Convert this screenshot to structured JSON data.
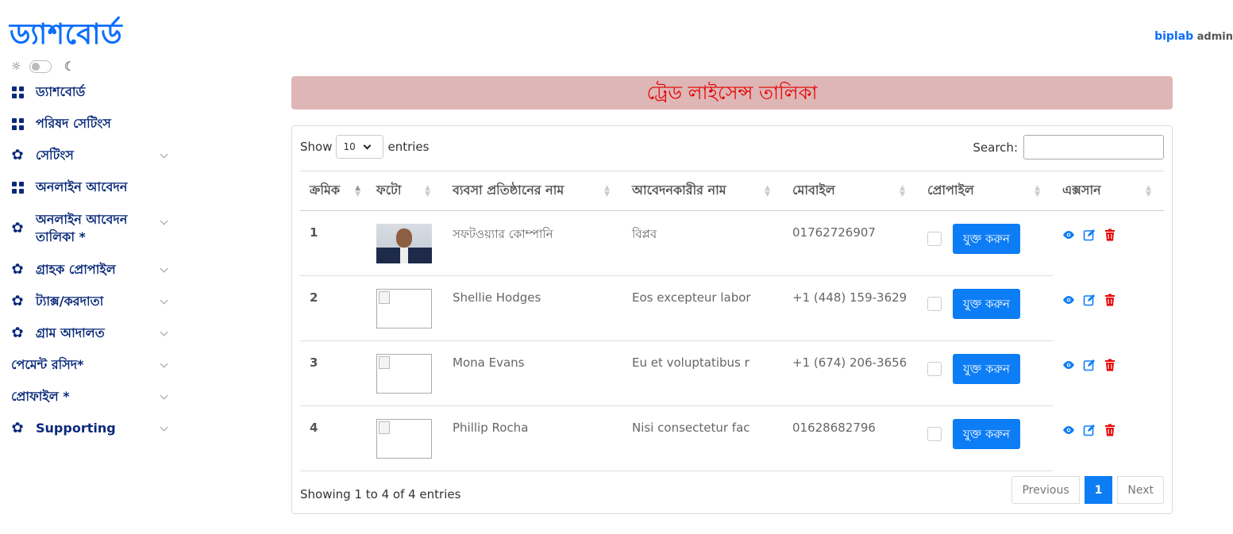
{
  "brand": "ড্যাশবোর্ড",
  "user": {
    "name": "biplab",
    "role": "admin"
  },
  "sidebar": {
    "items": [
      {
        "label": "ড্যাশবোর্ড",
        "icon": "grid-icon",
        "has_children": false
      },
      {
        "label": "পরিষদ সেটিংস",
        "icon": "grid-icon",
        "has_children": false
      },
      {
        "label": "সেটিংস",
        "icon": "gear-icon",
        "has_children": true
      },
      {
        "label": "অনলাইন আবেদন",
        "icon": "grid-icon",
        "has_children": false
      },
      {
        "label": "অনলাইন আবেদন তালিকা *",
        "icon": "gear-icon",
        "has_children": true
      },
      {
        "label": "গ্রাহক প্রোপাইল",
        "icon": "gear-icon",
        "has_children": true
      },
      {
        "label": "ট্যাক্স/করদাতা",
        "icon": "gear-icon",
        "has_children": true
      },
      {
        "label": "গ্রাম আদালত",
        "icon": "gear-icon",
        "has_children": true
      },
      {
        "label": "পেমেন্ট রসিদ*",
        "icon": "",
        "has_children": true
      },
      {
        "label": "প্রোফাইল *",
        "icon": "",
        "has_children": true
      },
      {
        "label": "Supporting",
        "icon": "gear-icon",
        "has_children": true
      }
    ]
  },
  "page_title": "ট্রেড লাইসেন্স তালিকা",
  "table_controls": {
    "show_label": "Show",
    "page_size": "10",
    "entries_label": "entries",
    "search_label": "Search:",
    "search_value": ""
  },
  "table": {
    "columns": [
      "ক্রমিক",
      "ফটো",
      "ব্যবসা প্রতিষ্ঠানের নাম",
      "আবেদনকারীর নাম",
      "মোবাইল",
      "প্রোপাইল",
      "এক্সসান"
    ],
    "rows": [
      {
        "serial": "1",
        "photo": "photo",
        "business": "সফটওয়্যার কোম্পানি",
        "applicant": "বিপ্লব",
        "mobile": "01762726907",
        "action_label": "যুক্ত করুন"
      },
      {
        "serial": "2",
        "photo": "broken",
        "business": "Shellie Hodges",
        "applicant": "Eos excepteur labor",
        "mobile": "+1 (448) 159-3629",
        "action_label": "যুক্ত করুন"
      },
      {
        "serial": "3",
        "photo": "broken",
        "business": "Mona Evans",
        "applicant": "Eu et voluptatibus r",
        "mobile": "+1 (674) 206-3656",
        "action_label": "যুক্ত করুন"
      },
      {
        "serial": "4",
        "photo": "broken",
        "business": "Phillip Rocha",
        "applicant": "Nisi consectetur fac",
        "mobile": "01628682796",
        "action_label": "যুক্ত করুন"
      }
    ]
  },
  "footer": {
    "info": "Showing 1 to 4 of 4 entries",
    "previous": "Previous",
    "current_page": "1",
    "next": "Next"
  },
  "colors": {
    "accent": "#0d7df5",
    "title_bg": "#deb6b6",
    "title_text": "#e60000",
    "nav_text": "#0a2a7a",
    "delete": "#e60000"
  }
}
